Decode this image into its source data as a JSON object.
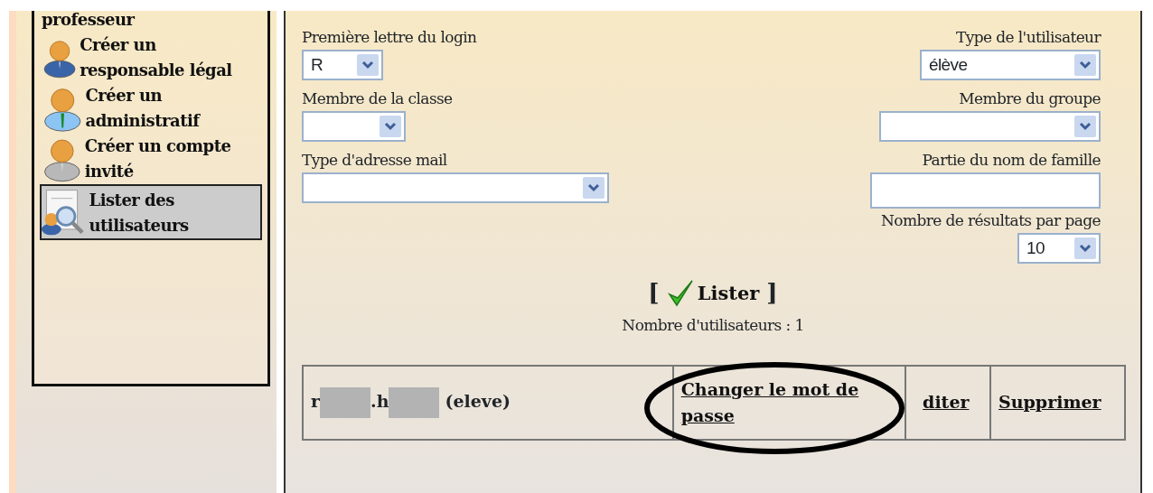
{
  "sidebar": {
    "items": [
      {
        "kind": "text",
        "label": "professeur",
        "selected": false
      },
      {
        "kind": "parent",
        "label": "Créer un responsable légal",
        "selected": false
      },
      {
        "kind": "admin",
        "label": "Créer un administratif",
        "selected": false
      },
      {
        "kind": "guest",
        "label": "Créer un compte invité",
        "selected": false
      },
      {
        "kind": "list",
        "label": "Lister des utilisateurs",
        "selected": true
      }
    ]
  },
  "filters": {
    "left": [
      {
        "kind": "select",
        "label": "Première lettre du login",
        "value": "R"
      },
      {
        "kind": "select",
        "label": "Membre de la classe"
      },
      {
        "kind": "select",
        "label": "Type d'adresse mail"
      }
    ],
    "right": [
      {
        "kind": "select",
        "label": "Type de l'utilisateur",
        "value": "élève"
      },
      {
        "kind": "select",
        "label": "Membre du groupe"
      },
      {
        "kind": "text",
        "label": "Partie du nom de famille"
      },
      {
        "kind": "select",
        "label": "Nombre de résultats par page",
        "value": "10"
      }
    ]
  },
  "list_button": {
    "open": "[",
    "label": "Lister",
    "close": "]"
  },
  "user_count": "Nombre d'utilisateurs : 1",
  "table": {
    "rows": [
      {
        "name_parts": [
          {
            "kind": "text",
            "text": "r"
          },
          {
            "kind": "redacted"
          },
          {
            "kind": "text",
            "text": ".h"
          },
          {
            "kind": "redacted"
          },
          {
            "kind": "text",
            "text": "(eleve)"
          }
        ],
        "change_password": "Changer le mot de passe",
        "edit": "diter",
        "delete": "Supprimer",
        "circled": true
      }
    ]
  }
}
